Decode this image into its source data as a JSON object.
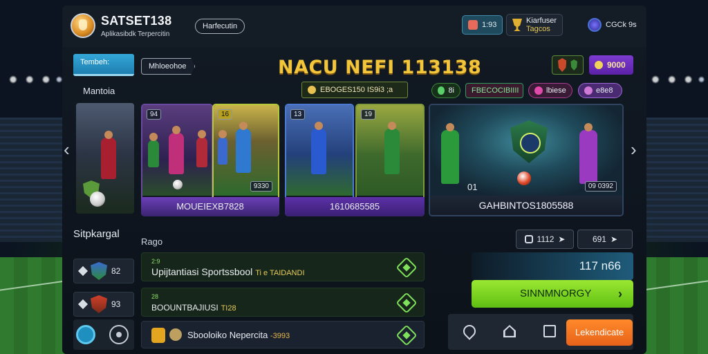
{
  "header": {
    "brand": "SATSET138",
    "brand_sub": "Aplikasibdk Terpercitin",
    "pill_link": "Harfecutin",
    "btn_1": "1:93",
    "btn_2_line1": "Kiarfuser",
    "btn_2_line2": "Tagcos",
    "btn_3": "CGCk 9s"
  },
  "sidebar": {
    "tab": "Tembeh:",
    "label": "Mantoia",
    "section_title": "Sitpkargal",
    "rows": [
      {
        "value": "82"
      },
      {
        "value": "93"
      }
    ]
  },
  "main": {
    "sub_pill": "Mhloeohoe",
    "title": "NACU NEFI 113138",
    "promo": "EBOGES150 IS9i3 ;a",
    "top_right_btn_1": "",
    "top_right_btn_2": "9000",
    "chips": [
      "8i",
      "FBECOCIBIIII",
      "lbiese",
      "e8e8"
    ],
    "cards": [
      {
        "tag": "94",
        "caption": ""
      },
      {
        "tag": "16",
        "extra": "9330",
        "caption": ""
      },
      {
        "tag": "13",
        "caption": ""
      },
      {
        "tag": "19",
        "caption": ""
      },
      {
        "tag": "01",
        "extra": "09 0392",
        "caption": "GAHBINTOS1805588"
      }
    ],
    "caption_12": "MOUEIEXB7828",
    "caption_34": "1610685585",
    "section_label": "Rago",
    "list": [
      {
        "top": "2:9",
        "main": "Upijtantiasi Sportssbool",
        "hl": "Ti e TAIDANDI"
      },
      {
        "top": "28",
        "main": "BOOUNTBAJIUSI",
        "hl": "TI28"
      },
      {
        "top": "",
        "main": "Sbooloiko  Nepercita",
        "hl": "-3993"
      }
    ]
  },
  "right_panel": {
    "stat_1": "1112",
    "stat_2": "691",
    "balance": "117 n66",
    "cta": "SINNMNORGY",
    "orange_button": "Lekendicate"
  }
}
